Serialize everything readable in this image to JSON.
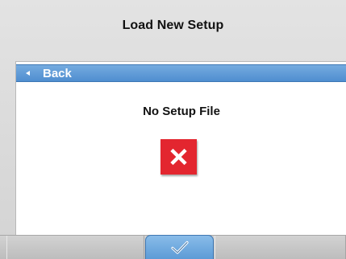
{
  "window": {
    "title": "Load New Setup"
  },
  "navigation": {
    "back_label": "Back",
    "back_icon": "left-arrow-icon"
  },
  "content": {
    "message": "No Setup File",
    "status_icon": "error-x-icon",
    "status_color": "#e3262f"
  },
  "footer": {
    "confirm_icon": "checkmark-icon"
  },
  "colors": {
    "accent": "#5c9bd6",
    "background": "#d8d8d8",
    "panel": "#ffffff"
  }
}
